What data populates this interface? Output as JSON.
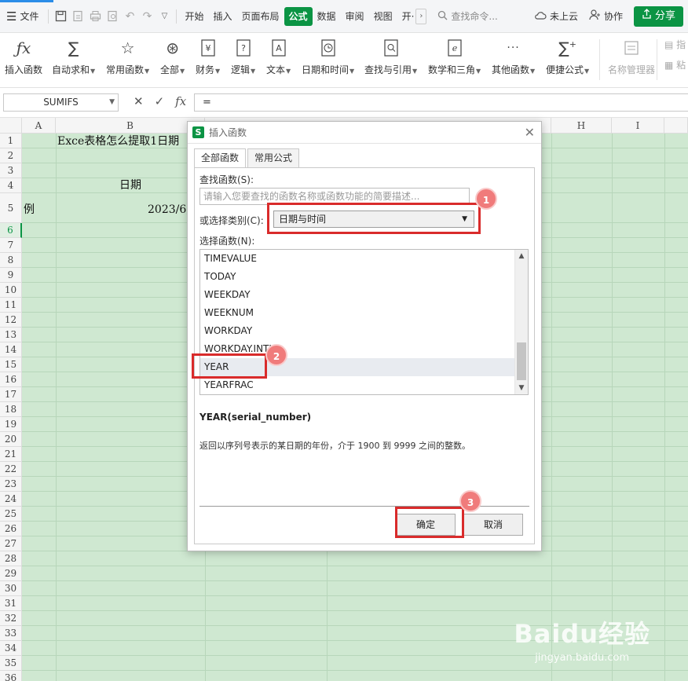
{
  "menubar": {
    "file_label": "文件",
    "tabs": [
      "开始",
      "插入",
      "页面布局",
      "公式",
      "数据",
      "审阅",
      "视图",
      "开·"
    ],
    "active_tab": "公式",
    "search_placeholder": "查找命令...",
    "cloud_label": "未上云",
    "collab_label": "协作",
    "share_label": "分享"
  },
  "ribbon": {
    "buttons": [
      {
        "label": "插入函数",
        "icon": "fx-icon"
      },
      {
        "label": "自动求和",
        "icon": "sigma-icon"
      },
      {
        "label": "常用函数",
        "icon": "star-icon"
      },
      {
        "label": "全部",
        "icon": "all-icon"
      },
      {
        "label": "财务",
        "icon": "yen-icon"
      },
      {
        "label": "逻辑",
        "icon": "question-icon"
      },
      {
        "label": "文本",
        "icon": "text-a-icon"
      },
      {
        "label": "日期和时间",
        "icon": "clock-icon"
      },
      {
        "label": "查找与引用",
        "icon": "lookup-icon"
      },
      {
        "label": "数学和三角",
        "icon": "math-e-icon"
      },
      {
        "label": "其他函数",
        "icon": "more-dots-icon"
      },
      {
        "label": "便捷公式",
        "icon": "sigma-plus-icon"
      },
      {
        "label": "名称管理器",
        "icon": "name-manager-icon"
      }
    ],
    "right_cut": [
      "指",
      "粘"
    ]
  },
  "formula_bar": {
    "name_box": "SUMIFS",
    "formula": "="
  },
  "grid": {
    "columns": [
      "A",
      "B",
      "H",
      "I"
    ],
    "rows": [
      "1",
      "2",
      "3",
      "4",
      "5",
      "6",
      "7",
      "8",
      "9",
      "10",
      "11",
      "12",
      "13",
      "14",
      "15",
      "16",
      "17",
      "18",
      "19",
      "20",
      "21",
      "22",
      "23",
      "24",
      "25",
      "26",
      "27",
      "28",
      "29",
      "30",
      "31",
      "32",
      "33",
      "34",
      "35",
      "36"
    ],
    "active_row": "6",
    "cells": {
      "b1": "Exce表格怎么提取1日期",
      "b4": "日期",
      "a5": "例",
      "b5": "2023/6,"
    }
  },
  "dialog": {
    "title": "插入函数",
    "tabs": [
      "全部函数",
      "常用公式"
    ],
    "search_label": "查找函数(S):",
    "search_placeholder": "请输入您要查找的函数名称或函数功能的简要描述...",
    "category_label": "或选择类别(C):",
    "category_value": "日期与时间",
    "list_label": "选择函数(N):",
    "functions": [
      "TIMEVALUE",
      "TODAY",
      "WEEKDAY",
      "WEEKNUM",
      "WORKDAY",
      "WORKDAY.INTL",
      "YEAR",
      "YEARFRAC"
    ],
    "selected_function": "YEAR",
    "signature": "YEAR(serial_number)",
    "description": "返回以序列号表示的某日期的年份，介于 1900 到 9999 之间的整数。",
    "ok_label": "确定",
    "cancel_label": "取消"
  },
  "annotations": {
    "badges": [
      "1",
      "2",
      "3"
    ],
    "color": "#d92b2b"
  },
  "watermark": {
    "logo": "Baidu经验",
    "url": "jingyan.baidu.com"
  },
  "colors": {
    "accent_green": "#0b9444",
    "grid_bg": "#cfe8d1"
  }
}
